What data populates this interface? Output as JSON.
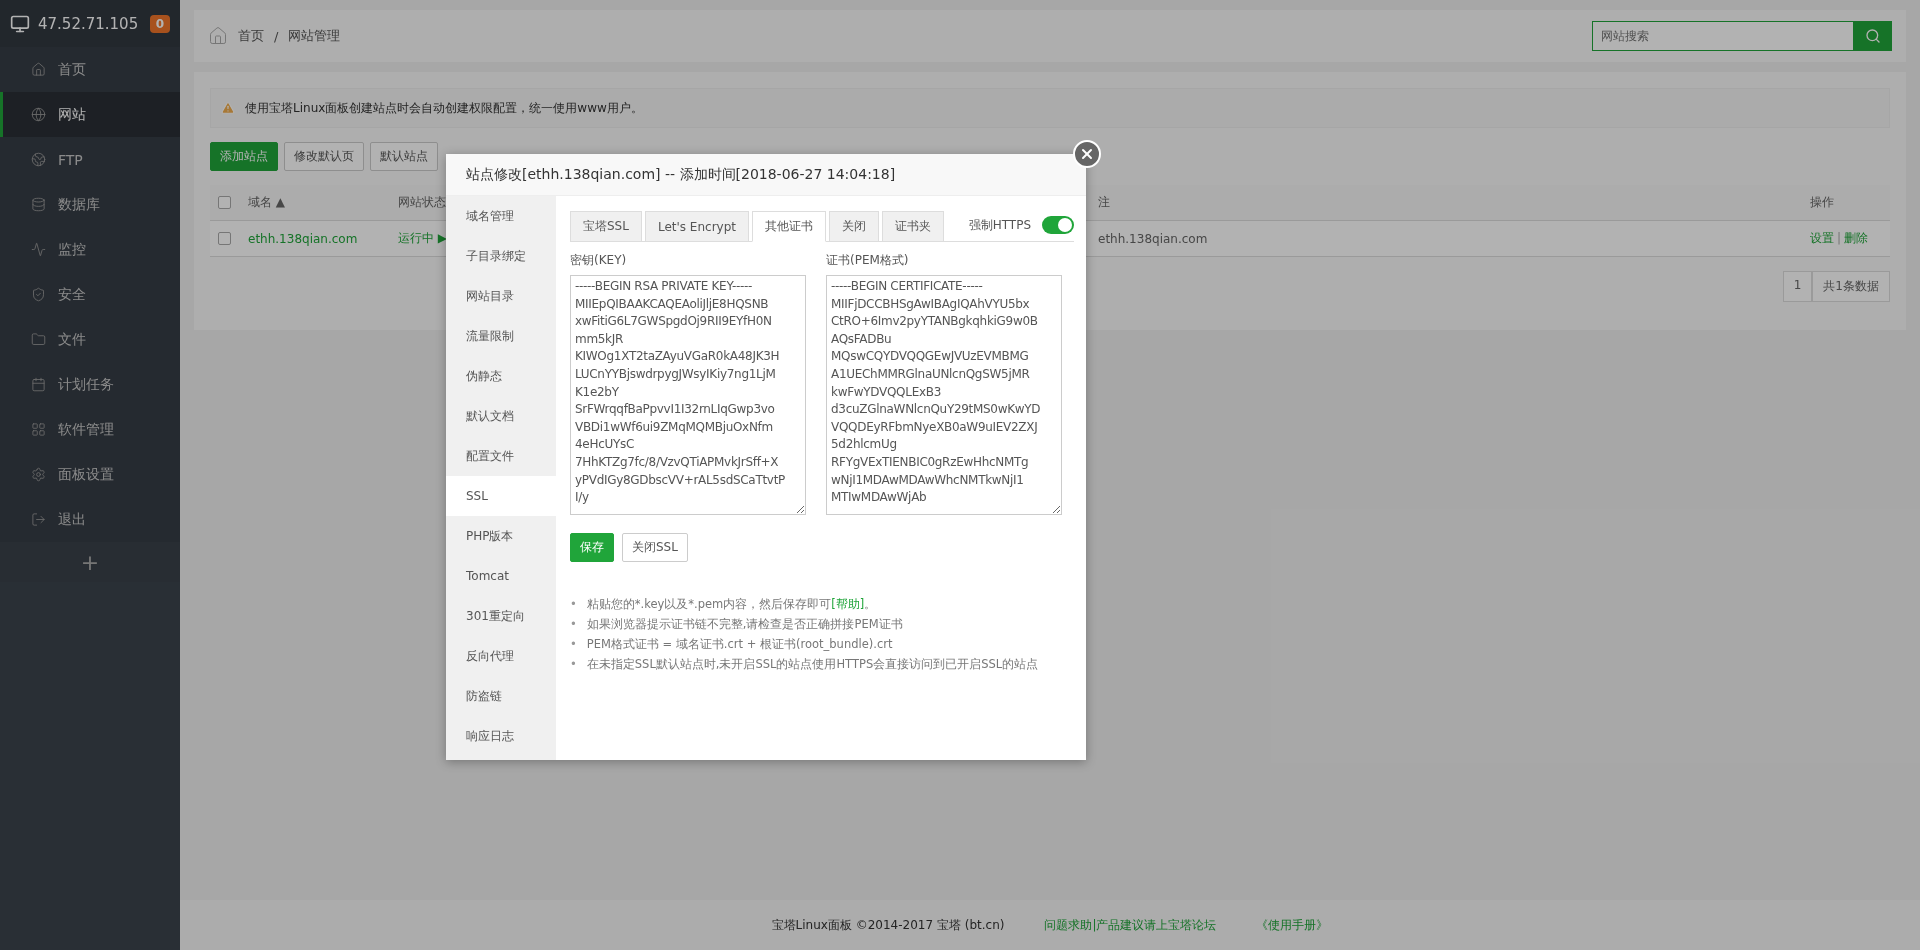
{
  "server": {
    "ip": "47.52.71.105",
    "badge": "0"
  },
  "sidebar": {
    "items": [
      {
        "kind": "home",
        "label": "首页",
        "selected": false
      },
      {
        "kind": "site",
        "label": "网站",
        "selected": true
      },
      {
        "kind": "ftp",
        "label": "FTP",
        "selected": false
      },
      {
        "kind": "db",
        "label": "数据库",
        "selected": false
      },
      {
        "kind": "monitor",
        "label": "监控",
        "selected": false
      },
      {
        "kind": "security",
        "label": "安全",
        "selected": false
      },
      {
        "kind": "files",
        "label": "文件",
        "selected": false
      },
      {
        "kind": "cron",
        "label": "计划任务",
        "selected": false
      },
      {
        "kind": "soft",
        "label": "软件管理",
        "selected": false
      },
      {
        "kind": "settings",
        "label": "面板设置",
        "selected": false
      },
      {
        "kind": "logout",
        "label": "退出",
        "selected": false
      }
    ],
    "add": "+"
  },
  "breadcrumb": [
    "首页",
    "网站管理"
  ],
  "breadcrumb_separator": "/",
  "search": {
    "placeholder": "网站搜索"
  },
  "alert": "使用宝塔Linux面板创建站点时会自动创建权限配置，统一使用www用户。",
  "toolbar": [
    "添加站点",
    "修改默认页",
    "默认站点"
  ],
  "table": {
    "select_all_checked": false,
    "columns": [
      "域名 ▲",
      "网站状态",
      "注",
      "操作"
    ],
    "rows": [
      {
        "checked": false,
        "domain": "ethh.138qian.com",
        "status": "运行中 ▶",
        "note": "ethh.138qian.com",
        "actions": [
          "设置",
          "删除"
        ],
        "action_separator": "|"
      }
    ]
  },
  "pagination": {
    "page": "1",
    "total": "共1条数据"
  },
  "footer": {
    "copyright": "宝塔Linux面板 ©2014-2017 宝塔 (bt.cn)",
    "links": [
      "问题求助|产品建议请上宝塔论坛",
      "《使用手册》"
    ]
  },
  "dialog": {
    "title": "站点修改[ethh.138qian.com] -- 添加时间[2018-06-27 14:04:18]",
    "menu": [
      {
        "label": "域名管理",
        "selected": false
      },
      {
        "label": "子目录绑定",
        "selected": false
      },
      {
        "label": "网站目录",
        "selected": false
      },
      {
        "label": "流量限制",
        "selected": false
      },
      {
        "label": "伪静态",
        "selected": false
      },
      {
        "label": "默认文档",
        "selected": false
      },
      {
        "label": "配置文件",
        "selected": false
      },
      {
        "label": "SSL",
        "selected": true
      },
      {
        "label": "PHP版本",
        "selected": false
      },
      {
        "label": "Tomcat",
        "selected": false
      },
      {
        "label": "301重定向",
        "selected": false
      },
      {
        "label": "反向代理",
        "selected": false
      },
      {
        "label": "防盗链",
        "selected": false
      },
      {
        "label": "响应日志",
        "selected": false
      }
    ],
    "tabs": [
      {
        "label": "宝塔SSL",
        "selected": false
      },
      {
        "label": "Let's Encrypt",
        "selected": false
      },
      {
        "label": "其他证书",
        "selected": true
      },
      {
        "label": "关闭",
        "selected": false
      },
      {
        "label": "证书夹",
        "selected": false
      }
    ],
    "force_https": {
      "label": "强制HTTPS",
      "on": true
    },
    "key": {
      "label": "密钥(KEY)",
      "lines": [
        "-----BEGIN RSA PRIVATE KEY-----",
        "MIIEpQIBAAKCAQEAoliJljE8HQSNB",
        "xwFitiG6L7GWSpgdOj9RII9EYfH0N",
        "mm5kJR",
        "KIWOg1XT2taZAyuVGaR0kA48JK3H",
        "LUCnYYBjswdrpygJWsyIKiy7ng1LjM",
        "K1e2bY",
        "SrFWrqqfBaPpvvI1I32rnLIqGwp3vo",
        "VBDi1wWf6ui9ZMqMQMBjuOxNfm",
        "4eHcUYsC",
        "7HhKTZg7fc/8/VzvQTiAPMvkJrSff+X",
        "yPVdIGy8GDbscVV+rAL5sdSCaTtvtP",
        "I/y"
      ]
    },
    "cert": {
      "label": "证书(PEM格式)",
      "lines": [
        "-----BEGIN CERTIFICATE-----",
        "MIIFjDCCBHSgAwIBAgIQAhVYU5bx",
        "CtRO+6Imv2pyYTANBgkqhkiG9w0B",
        "AQsFADBu",
        "MQswCQYDVQQGEwJVUzEVMBMG",
        "A1UEChMMRGlnaUNlcnQgSW5jMR",
        "kwFwYDVQQLExB3",
        "d3cuZGlnaWNlcnQuY29tMS0wKwYD",
        "VQQDEyRFbmNyeXB0aW9uIEV2ZXJ",
        "5d2hlcmUg",
        "RFYgVExTIENBIC0gRzEwHhcNMTg",
        "wNjI1MDAwMDAwWhcNMTkwNjI1",
        "MTIwMDAwWjAb"
      ]
    },
    "buttons": [
      {
        "kind": "primary",
        "label": "保存"
      },
      {
        "kind": "default",
        "label": "关闭SSL"
      }
    ],
    "notes": [
      "粘贴您的*.key以及*.pem内容，然后保存即可",
      "如果浏览器提示证书链不完整,请检查是否正确拼接PEM证书",
      "PEM格式证书 = 域名证书.crt + 根证书(root_bundle).crt",
      "在未指定SSL默认站点时,未开启SSL的站点使用HTTPS会直接访问到已开启SSL的站点"
    ],
    "bullet": "•",
    "help_link": "[帮助]",
    "help_suffix": "。"
  }
}
